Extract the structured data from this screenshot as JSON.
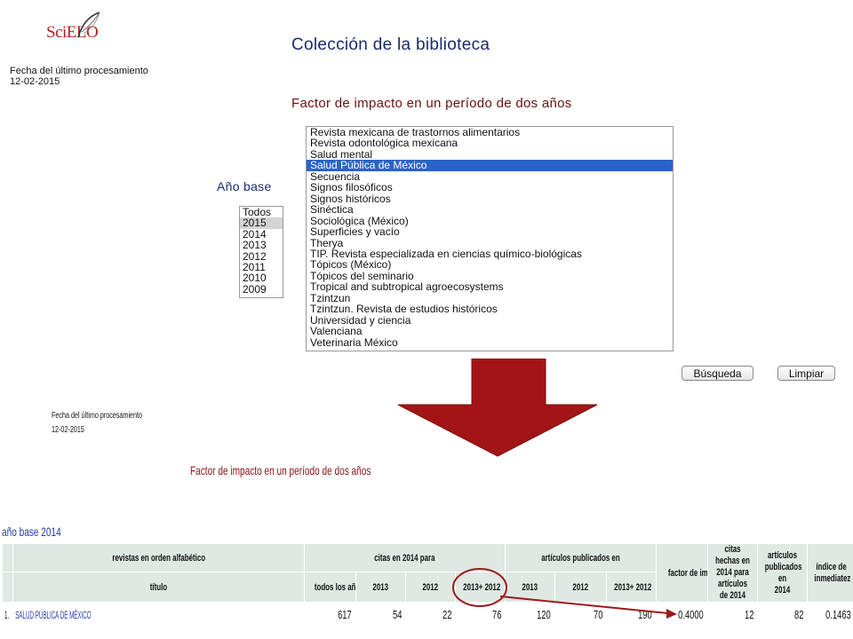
{
  "logo": {
    "sci": "Sci",
    "elo": "ELO"
  },
  "header": {
    "date_label": "Fecha del último procesamiento",
    "date_value": "12-02-2015",
    "title": "Colección de la biblioteca",
    "subtitle": "Factor de impacto en un período de dos años"
  },
  "year_selector": {
    "label": "Año base",
    "options": [
      "Todos",
      "2015",
      "2014",
      "2013",
      "2012",
      "2011",
      "2010",
      "2009"
    ],
    "selected_index": 1
  },
  "journal_list": {
    "items": [
      "Revista mexicana de trastornos alimentarios",
      "Revista odontológica mexicana",
      "Salud mental",
      "Salud Pública de México",
      "Secuencia",
      "Signos filosóficos",
      "Signos históricos",
      "Sinéctica",
      "Sociológica (México)",
      "Superficies y vacío",
      "Therya",
      "TIP. Revista especializada en ciencias químico-biológicas",
      "Tópicos (México)",
      "Tópicos del seminario",
      "Tropical and subtropical agroecosystems",
      "Tzintzun",
      "Tzintzun. Revista de estudios históricos",
      "Universidad y ciencia",
      "Valenciana",
      "Veterinaria México"
    ],
    "selected_index": 3
  },
  "buttons": {
    "search": "Búsqueda",
    "clear": "Limpiar"
  },
  "result": {
    "date_label": "Fecha del último procesamiento",
    "date_value": "12-02-2015",
    "subtitle": "Factor de impacto en un período de dos años",
    "base_year_label": "año base 2014",
    "table": {
      "h_journals": "revistas en orden alfabético",
      "h_citations": "citas en 2014 para",
      "h_articles": "artículos publicados en",
      "h_impact": "factor de impacto",
      "h_cites_2014": [
        "citas hechas en",
        "2014 para",
        "artículos de 2014"
      ],
      "h_articles_2014": [
        "artículos",
        "publicados en",
        "2014"
      ],
      "h_immediacy": [
        "índice de",
        "inmediatez"
      ],
      "h_title": "título",
      "h_all_years": "todos los años",
      "h_2013": "2013",
      "h_2012": "2012",
      "h_sum": "2013+ 2012",
      "row": {
        "num": "1.",
        "title": "SALUD PÚBLICA DE MÉXICO",
        "all_years": "617",
        "c2013": "54",
        "c2012": "22",
        "csum": "76",
        "a2013": "120",
        "a2012": "70",
        "asum": "190",
        "impact": "0.4000",
        "cites_2014": "12",
        "articles_2014": "82",
        "immediacy": "0.1463"
      }
    }
  },
  "colors": {
    "title_blue": "#1a2b6b",
    "subtitle_red": "#6b1010",
    "selection_blue": "#2a63c9",
    "arrow_red": "#a31515",
    "table_header": "#dfe8e3",
    "link_blue": "#2636b5"
  }
}
